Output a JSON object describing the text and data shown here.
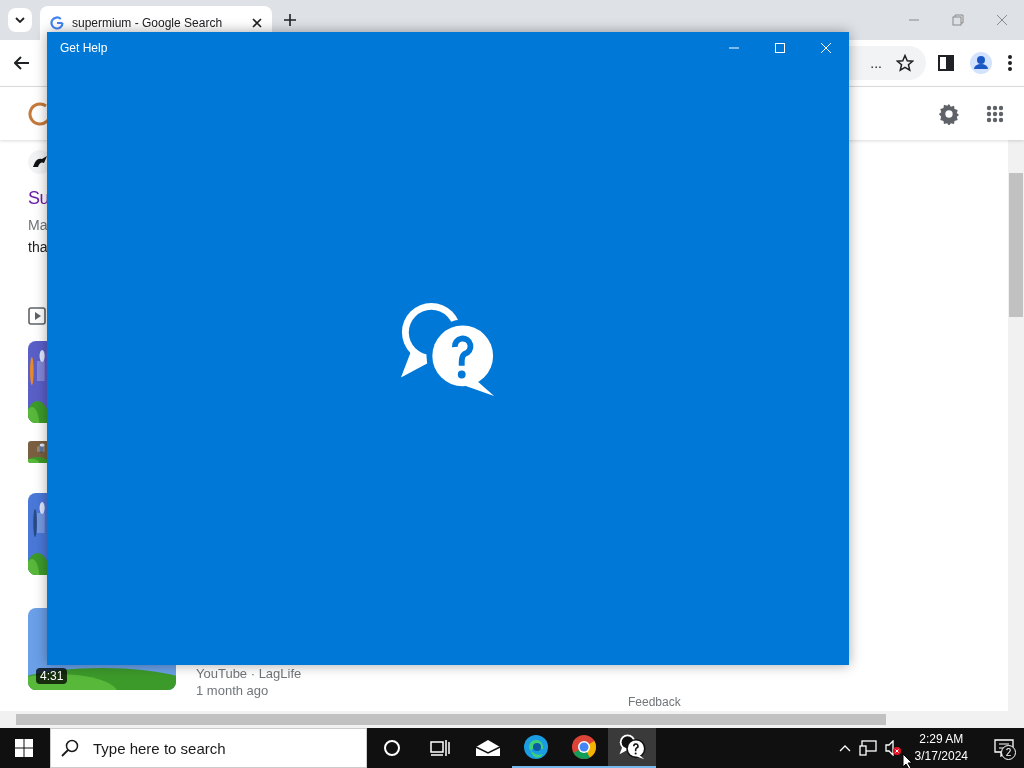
{
  "browser": {
    "tab": {
      "title": "supermium - Google Search"
    },
    "omnibox": {
      "text": "..."
    },
    "results": {
      "site_title": "Su",
      "snippet_line_1": "Ma",
      "snippet_line_2": "tha",
      "videos": [
        {
          "kind": "picture"
        },
        {
          "kind": "picture"
        },
        {
          "kind": "picture",
          "duration": "4:31",
          "source": "YouTube · LagLife",
          "age": "1 month ago"
        }
      ]
    },
    "feedback": "Feedback"
  },
  "dialog": {
    "title": "Get Help"
  },
  "taskbar": {
    "search": {
      "placeholder": "Type here to search"
    },
    "apps": [
      {
        "kind": "cortana",
        "running": false,
        "selected": false
      },
      {
        "kind": "task-view",
        "running": false,
        "selected": false
      },
      {
        "kind": "mail",
        "running": false,
        "selected": false
      },
      {
        "kind": "edge",
        "running": true,
        "selected": false
      },
      {
        "kind": "chrome",
        "running": true,
        "selected": false
      },
      {
        "kind": "help",
        "running": true,
        "selected": true
      }
    ],
    "clock": {
      "time": "2:29 AM",
      "date": "3/17/2024"
    },
    "notifications": "2"
  }
}
